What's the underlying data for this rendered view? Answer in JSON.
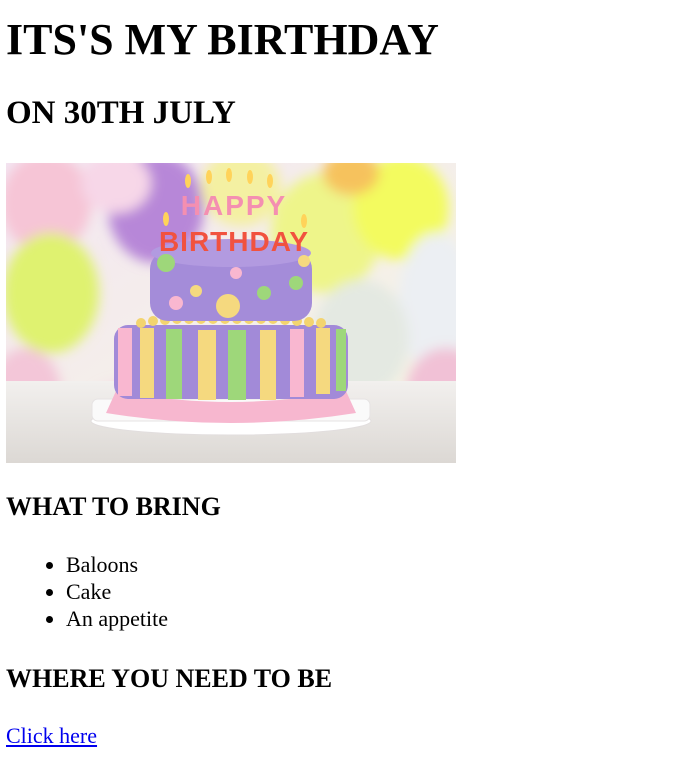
{
  "page": {
    "title": "ITS'S MY BIRTHDAY",
    "subtitle": "ON 30TH JULY",
    "image": {
      "subject": "birthday-cake",
      "cake_candles_text": "HAPPY BIRTHDAY"
    },
    "bring_heading": "WHAT TO BRING",
    "bring_items": [
      "Baloons",
      "Cake",
      "An appetite"
    ],
    "where_heading": "WHERE YOU NEED TO BE",
    "link_text": "Click here"
  },
  "colors": {
    "link": "#0000ee",
    "text": "#000000",
    "background": "#ffffff"
  }
}
